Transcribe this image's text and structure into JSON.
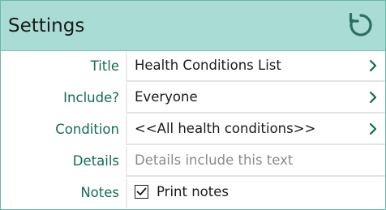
{
  "header": {
    "title": "Settings",
    "refresh_icon": "refresh-icon"
  },
  "accent_color": "#136b57",
  "header_color": "#a9dcd4",
  "rows": [
    {
      "label": "Title",
      "value": "Health Conditions List",
      "kind": "nav"
    },
    {
      "label": "Include?",
      "value": "Everyone",
      "kind": "nav"
    },
    {
      "label": "Condition",
      "value": "<<All health conditions>>",
      "kind": "nav"
    },
    {
      "label": "Details",
      "placeholder": "Details include this text",
      "kind": "input"
    },
    {
      "label": "Notes",
      "value": "Print notes",
      "checked": true,
      "kind": "checkbox"
    }
  ]
}
